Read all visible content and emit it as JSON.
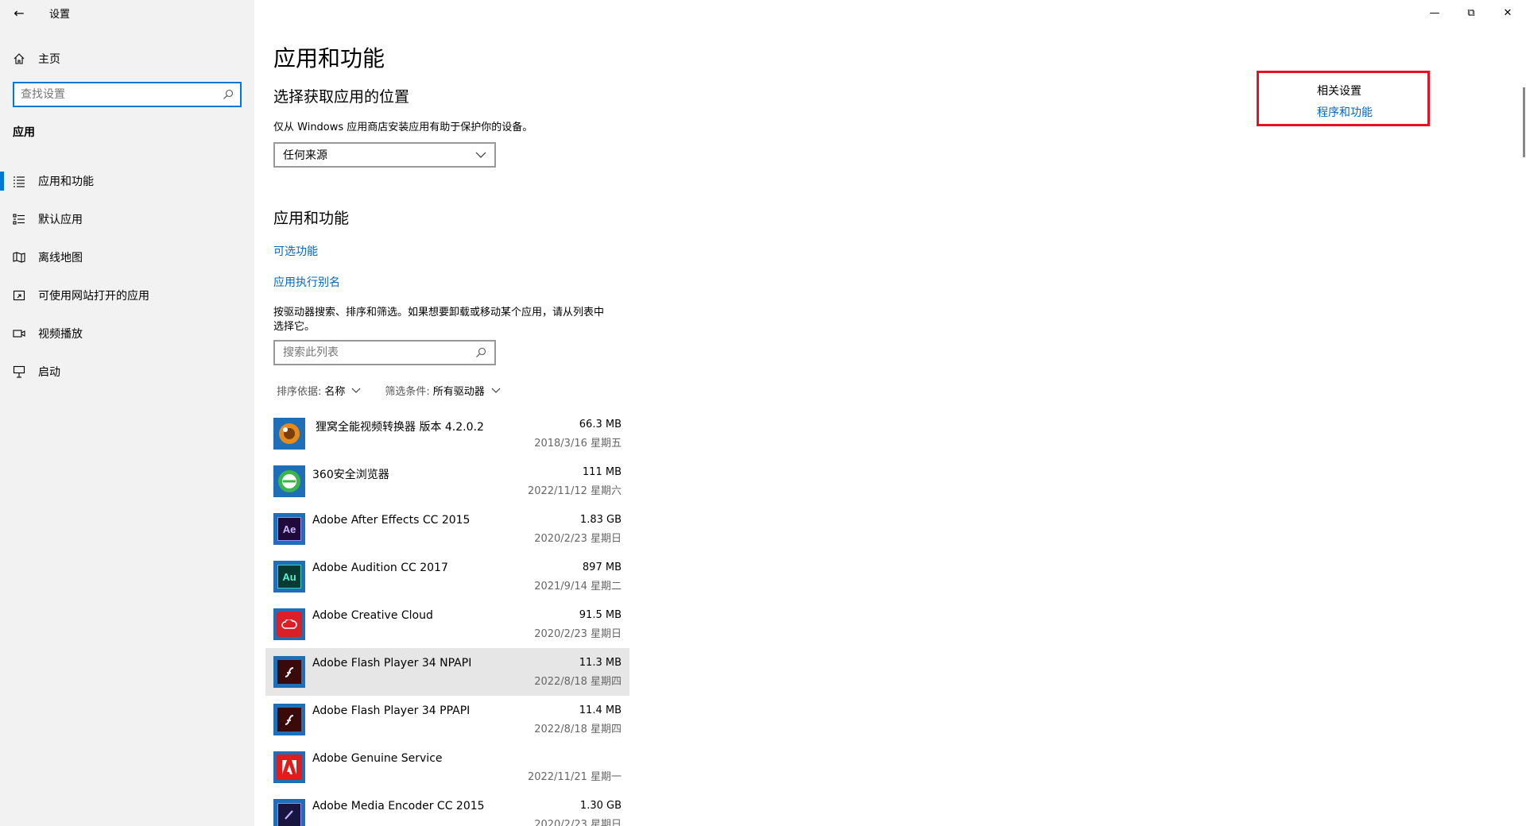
{
  "window": {
    "title": "设置",
    "back": "←",
    "minimize": "—",
    "restore": "⧉",
    "close": "✕"
  },
  "sidebar": {
    "home_label": "主页",
    "search_placeholder": "查找设置",
    "section": "应用",
    "items": [
      {
        "label": "应用和功能",
        "icon": "apps-list-icon"
      },
      {
        "label": "默认应用",
        "icon": "default-apps-icon"
      },
      {
        "label": "离线地图",
        "icon": "map-icon"
      },
      {
        "label": "可使用网站打开的应用",
        "icon": "website-apps-icon"
      },
      {
        "label": "视频播放",
        "icon": "video-icon"
      },
      {
        "label": "启动",
        "icon": "startup-icon"
      }
    ]
  },
  "main": {
    "title": "应用和功能",
    "location_heading": "选择获取应用的位置",
    "location_desc": "仅从 Windows 应用商店安装应用有助于保护你的设备。",
    "location_select": "任何来源",
    "apps_heading": "应用和功能",
    "optional_features": "可选功能",
    "app_aliases": "应用执行别名",
    "list_desc_1": "按驱动器搜索、排序和筛选。如果想要卸载或移动某个应用，请从列表中",
    "list_desc_2": "选择它。",
    "list_search_placeholder": "搜索此列表",
    "sort_label": "排序依据:",
    "sort_value": "名称",
    "filter_label": "筛选条件:",
    "filter_value": "所有驱动器",
    "apps": [
      {
        "name": "狸窝全能视频转换器 版本 4.2.0.2",
        "size": "66.3 MB",
        "date": "2018/3/16 星期五"
      },
      {
        "name": "360安全浏览器",
        "size": "111 MB",
        "date": "2022/11/12 星期六"
      },
      {
        "name": "Adobe After Effects CC 2015",
        "size": "1.83 GB",
        "date": "2020/2/23 星期日"
      },
      {
        "name": "Adobe Audition CC 2017",
        "size": "897 MB",
        "date": "2021/9/14 星期二"
      },
      {
        "name": "Adobe Creative Cloud",
        "size": "91.5 MB",
        "date": "2020/2/23 星期日"
      },
      {
        "name": "Adobe Flash Player 34 NPAPI",
        "size": "11.3 MB",
        "date": "2022/8/18 星期四"
      },
      {
        "name": "Adobe Flash Player 34 PPAPI",
        "size": "11.4 MB",
        "date": "2022/8/18 星期四"
      },
      {
        "name": "Adobe Genuine Service",
        "size": "",
        "date": "2022/11/21 星期一"
      },
      {
        "name": "Adobe Media Encoder CC 2015",
        "size": "1.30 GB",
        "date": "2020/2/23 星期日"
      }
    ]
  },
  "related": {
    "title": "相关设置",
    "link": "程序和功能"
  },
  "colors": {
    "accent": "#0078d7",
    "link": "#0067c0",
    "highlight_border": "#e81123",
    "sidebar_bg": "#f2f2f2"
  }
}
